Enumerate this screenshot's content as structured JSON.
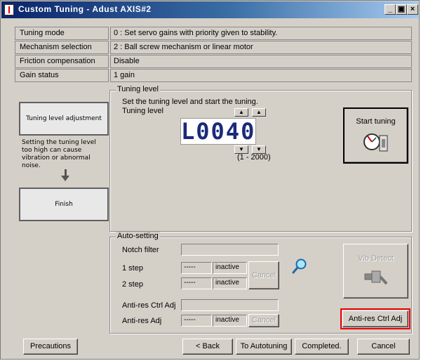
{
  "window": {
    "title": "Custom Tuning - Adust AXIS#2",
    "minimize_label": "_",
    "restore_label": "▣",
    "close_label": "×"
  },
  "info": [
    {
      "label": "Tuning mode",
      "value": "0 : Set servo gains with priority given to stability."
    },
    {
      "label": "Mechanism selection",
      "value": "2 : Ball screw mechanism or linear motor"
    },
    {
      "label": "Friction compensation",
      "value": "Disable"
    },
    {
      "label": "Gain status",
      "value": "1 gain"
    }
  ],
  "flow": {
    "step1": "Tuning level adjustment",
    "note": "Setting the tuning level\ntoo high can cause\nvibration or abnormal\nnoise.",
    "step2": "Finish"
  },
  "tuning_level": {
    "group_title": "Tuning level",
    "instruction": "Set the tuning level and start the tuning.",
    "label": "Tuning level",
    "display": "L0040",
    "range": "(1 - 2000)",
    "up_glyph": "▲",
    "down_glyph": "▼",
    "start_button": "Start tuning"
  },
  "auto_setting": {
    "group_title": "Auto-setting",
    "notch_filter_label": "Notch filter",
    "notch_filter_value": "",
    "step1_label": "1 step",
    "step1_value": "-----",
    "step1_status": "inactive",
    "step2_label": "2 step",
    "step2_value": "-----",
    "step2_status": "inactive",
    "cancel_label": "Cancel",
    "vib_detect_label": "Vib Detect",
    "anti_res_ctrl_label": "Anti-res Ctrl Adj",
    "anti_res_ctrl_value": "",
    "anti_res_adj_label": "Anti-res Adj",
    "anti_res_adj_value": "-----",
    "anti_res_adj_status": "inactive",
    "anti_res_cancel_label": "Cancel",
    "anti_res_ctrl_button": "Anti-res Ctrl Adj"
  },
  "footer": {
    "precautions": "Precautions",
    "back": "< Back",
    "to_autotuning": "To Autotuning",
    "completed": "Completed.",
    "cancel": "Cancel"
  },
  "colors": {
    "highlight": "#e00000",
    "lcd": "#1a2a7a",
    "title_bar": "#0a246a"
  }
}
